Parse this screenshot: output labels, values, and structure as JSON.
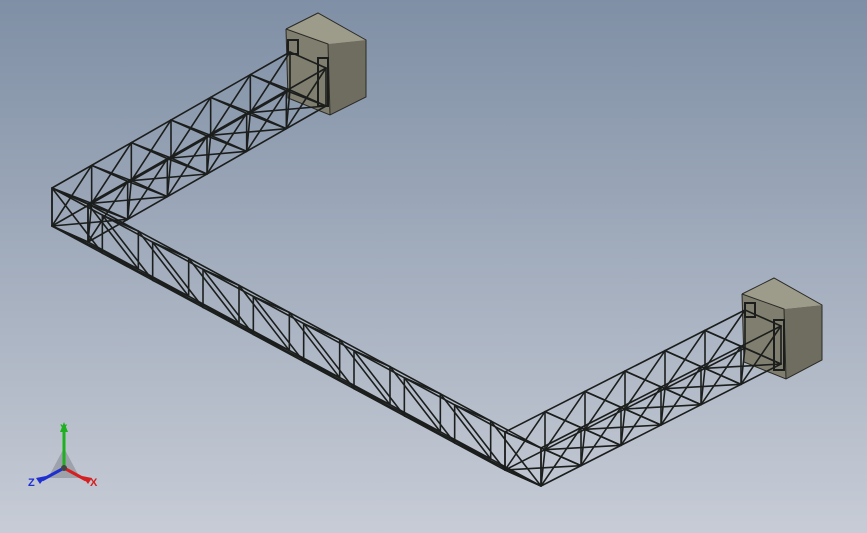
{
  "viewport": {
    "background_top": "#7f8fa5",
    "background_bottom": "#c7ccd6",
    "model": {
      "name": "",
      "truss_color": "#1b1e1c",
      "support_color": "#807e6e",
      "support_top_color": "#9d9b8a",
      "support_side_color": "#6f6d5f"
    }
  },
  "triad": {
    "x_label": "X",
    "y_label": "Y",
    "z_label": "Z",
    "x_color": "#d42020",
    "y_color": "#1fb020",
    "z_color": "#2030d0"
  }
}
